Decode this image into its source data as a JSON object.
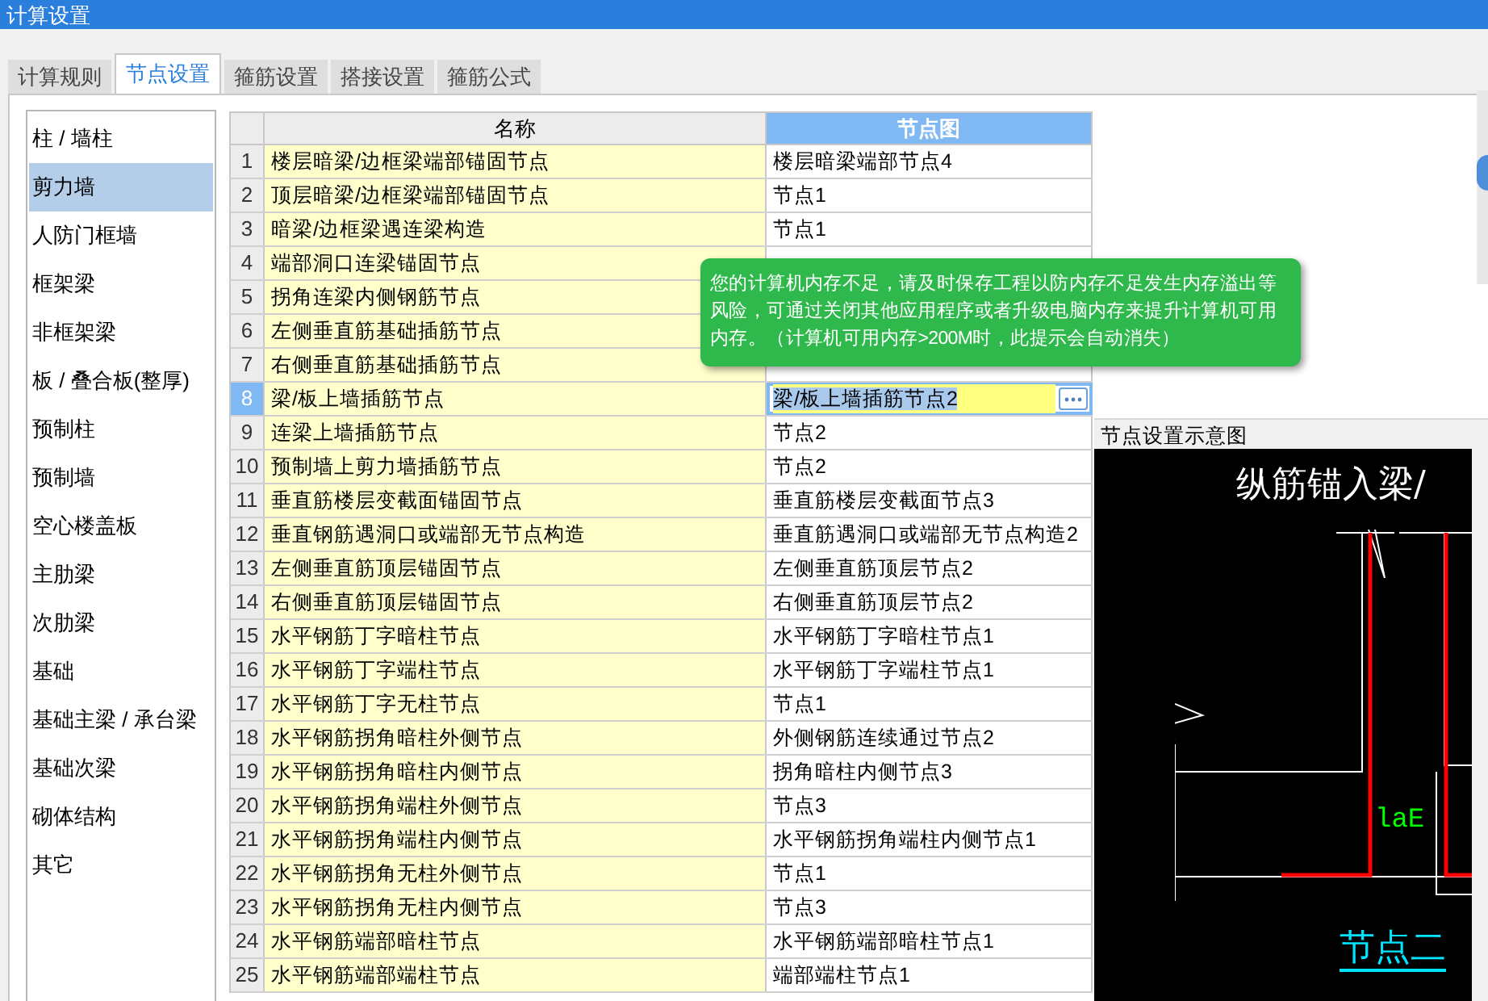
{
  "window": {
    "title": "计算设置"
  },
  "tabs": [
    {
      "label": "计算规则",
      "selected": false
    },
    {
      "label": "节点设置",
      "selected": true
    },
    {
      "label": "箍筋设置",
      "selected": false
    },
    {
      "label": "搭接设置",
      "selected": false
    },
    {
      "label": "箍筋公式",
      "selected": false
    }
  ],
  "sidebar": {
    "items": [
      {
        "label": "柱 / 墙柱",
        "selected": false
      },
      {
        "label": "剪力墙",
        "selected": true
      },
      {
        "label": "人防门框墙",
        "selected": false
      },
      {
        "label": "框架梁",
        "selected": false
      },
      {
        "label": "非框架梁",
        "selected": false
      },
      {
        "label": "板 / 叠合板(整厚)",
        "selected": false
      },
      {
        "label": "预制柱",
        "selected": false
      },
      {
        "label": "预制墙",
        "selected": false
      },
      {
        "label": "空心楼盖板",
        "selected": false
      },
      {
        "label": "主肋梁",
        "selected": false
      },
      {
        "label": "次肋梁",
        "selected": false
      },
      {
        "label": "基础",
        "selected": false
      },
      {
        "label": "基础主梁 / 承台梁",
        "selected": false
      },
      {
        "label": "基础次梁",
        "selected": false
      },
      {
        "label": "砌体结构",
        "selected": false
      },
      {
        "label": "其它",
        "selected": false
      }
    ]
  },
  "table": {
    "columns": [
      "名称",
      "节点图"
    ],
    "rows": [
      {
        "no": "1",
        "name": "楼层暗梁/边框梁端部锚固节点",
        "node": "楼层暗梁端部节点4",
        "selected": false
      },
      {
        "no": "2",
        "name": "顶层暗梁/边框梁端部锚固节点",
        "node": "节点1",
        "selected": false
      },
      {
        "no": "3",
        "name": "暗梁/边框梁遇连梁构造",
        "node": "节点1",
        "selected": false
      },
      {
        "no": "4",
        "name": "端部洞口连梁锚固节点",
        "selected": false
      },
      {
        "no": "5",
        "name": "拐角连梁内侧钢筋节点",
        "selected": false
      },
      {
        "no": "6",
        "name": "左侧垂直筋基础插筋节点",
        "selected": false
      },
      {
        "no": "7",
        "name": "右侧垂直筋基础插筋节点",
        "selected": false
      },
      {
        "no": "8",
        "name": "梁/板上墙插筋节点",
        "node": "梁/板上墙插筋节点2",
        "selected": true
      },
      {
        "no": "9",
        "name": "连梁上墙插筋节点",
        "node": "节点2",
        "selected": false
      },
      {
        "no": "10",
        "name": "预制墙上剪力墙插筋节点",
        "node": "节点2",
        "selected": false
      },
      {
        "no": "11",
        "name": "垂直筋楼层变截面锚固节点",
        "node": "垂直筋楼层变截面节点3",
        "selected": false
      },
      {
        "no": "12",
        "name": "垂直钢筋遇洞口或端部无节点构造",
        "node": "垂直筋遇洞口或端部无节点构造2",
        "selected": false
      },
      {
        "no": "13",
        "name": "左侧垂直筋顶层锚固节点",
        "node": "左侧垂直筋顶层节点2",
        "selected": false
      },
      {
        "no": "14",
        "name": "右侧垂直筋顶层锚固节点",
        "node": "右侧垂直筋顶层节点2",
        "selected": false
      },
      {
        "no": "15",
        "name": "水平钢筋丁字暗柱节点",
        "node": "水平钢筋丁字暗柱节点1",
        "selected": false
      },
      {
        "no": "16",
        "name": "水平钢筋丁字端柱节点",
        "node": "水平钢筋丁字端柱节点1",
        "selected": false
      },
      {
        "no": "17",
        "name": "水平钢筋丁字无柱节点",
        "node": "节点1",
        "selected": false
      },
      {
        "no": "18",
        "name": "水平钢筋拐角暗柱外侧节点",
        "node": "外侧钢筋连续通过节点2",
        "selected": false
      },
      {
        "no": "19",
        "name": "水平钢筋拐角暗柱内侧节点",
        "node": "拐角暗柱内侧节点3",
        "selected": false
      },
      {
        "no": "20",
        "name": "水平钢筋拐角端柱外侧节点",
        "node": "节点3",
        "selected": false
      },
      {
        "no": "21",
        "name": "水平钢筋拐角端柱内侧节点",
        "node": "水平钢筋拐角端柱内侧节点1",
        "selected": false
      },
      {
        "no": "22",
        "name": "水平钢筋拐角无柱外侧节点",
        "node": "节点1",
        "selected": false
      },
      {
        "no": "23",
        "name": "水平钢筋拐角无柱内侧节点",
        "node": "节点3",
        "selected": false
      },
      {
        "no": "24",
        "name": "水平钢筋端部暗柱节点",
        "node": "水平钢筋端部暗柱节点1",
        "selected": false
      },
      {
        "no": "25",
        "name": "水平钢筋端部端柱节点",
        "node": "端部端柱节点1",
        "selected": false
      }
    ]
  },
  "preview": {
    "title": "节点设置示意图",
    "heading": "纵筋锚入梁/",
    "dimension": "laE",
    "caption": "节点二"
  },
  "notification": {
    "text": "您的计算机内存不足，请及时保存工程以防内存不足发生内存溢出等风险，可通过关闭其他应用程序或者升级电脑内存来提升计算机可用内存。（计算机可用内存>200M时，此提示会自动消失）"
  }
}
